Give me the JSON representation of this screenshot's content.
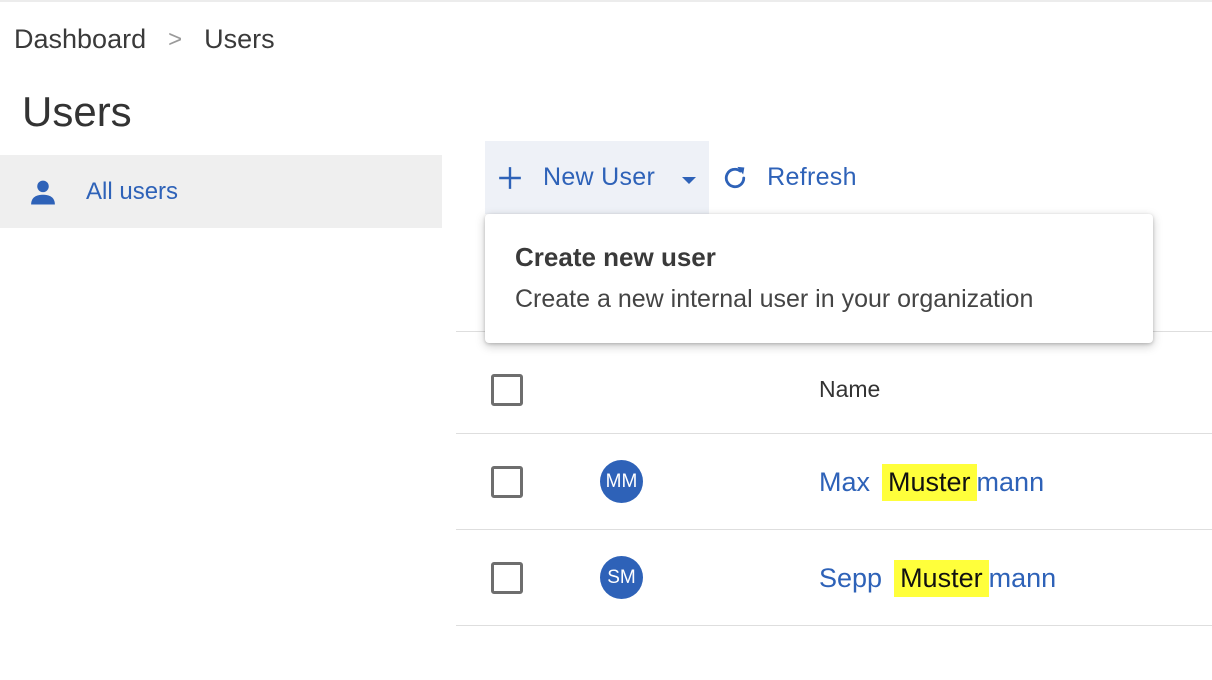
{
  "breadcrumb": {
    "items": [
      "Dashboard",
      "Users"
    ],
    "separator": ">"
  },
  "page": {
    "title": "Users"
  },
  "sidebar": {
    "items": [
      {
        "label": "All users",
        "icon": "person-icon"
      }
    ]
  },
  "toolbar": {
    "new_user_label": "New User",
    "refresh_label": "Refresh"
  },
  "dropdown_menu": {
    "title": "Create new user",
    "description": "Create a new internal user in your organization"
  },
  "table": {
    "columns": [
      "Name"
    ],
    "rows": [
      {
        "initials": "MM",
        "first": "Max",
        "highlight": "Muster",
        "rest": "mann"
      },
      {
        "initials": "SM",
        "first": "Sepp",
        "highlight": "Muster",
        "rest": "mann"
      }
    ]
  },
  "colors": {
    "accent": "#2e62b8",
    "highlight": "#ffff3b",
    "sidebar_active": "#efefef"
  }
}
